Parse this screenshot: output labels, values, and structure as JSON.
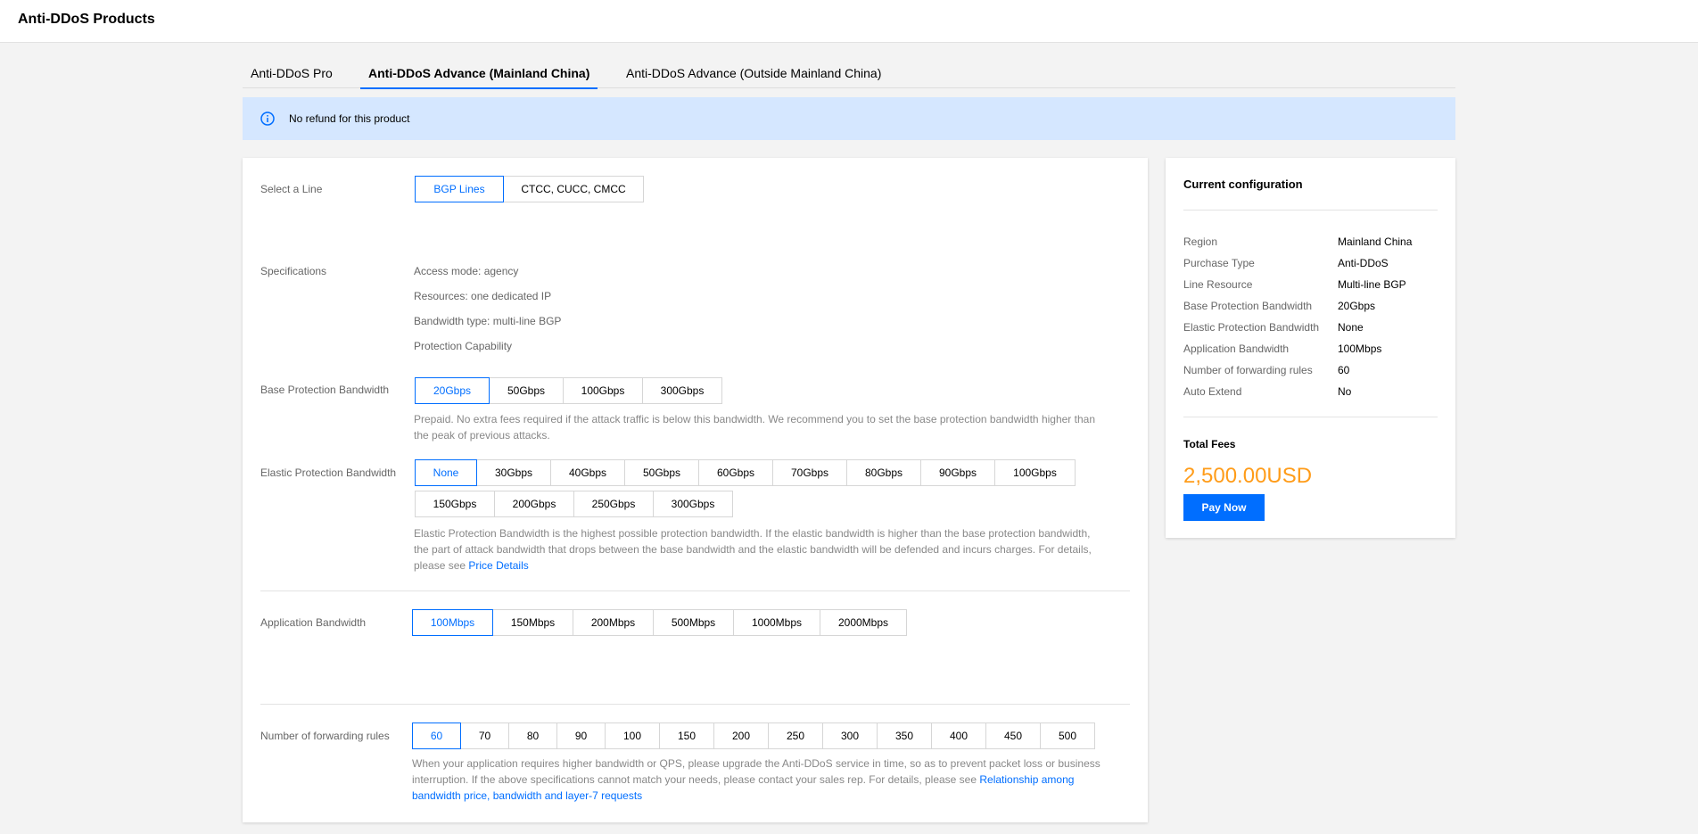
{
  "app": {
    "title": "Anti-DDoS Products"
  },
  "tabs": [
    {
      "label": "Anti-DDoS Pro",
      "active": false
    },
    {
      "label": "Anti-DDoS Advance (Mainland China)",
      "active": true
    },
    {
      "label": "Anti-DDoS Advance (Outside Mainland China)",
      "active": false
    }
  ],
  "notice": {
    "text": "No refund for this product",
    "icon": "info-icon"
  },
  "colors": {
    "accent": "#006eff",
    "notice_bg": "#d5e7ff",
    "fee": "#ff9c19"
  },
  "form": {
    "line": {
      "label": "Select a Line",
      "options": [
        "BGP Lines",
        "CTCC, CUCC, CMCC"
      ],
      "selected": "BGP Lines"
    },
    "specs": {
      "label": "Specifications",
      "items": [
        "Access mode: agency",
        "Resources: one dedicated IP",
        "Bandwidth type: multi-line BGP",
        "Protection Capability"
      ]
    },
    "base": {
      "label": "Base Protection Bandwidth",
      "options": [
        "20Gbps",
        "50Gbps",
        "100Gbps",
        "300Gbps"
      ],
      "selected": "20Gbps",
      "desc_line1": "Prepaid. No extra fees required if the attack traffic is below this bandwidth. We recommend you to set the base protection bandwidth higher than",
      "desc_line2": "the peak of previous attacks."
    },
    "elastic": {
      "label": "Elastic Protection Bandwidth",
      "options_row1": [
        "None",
        "30Gbps",
        "40Gbps",
        "50Gbps",
        "60Gbps",
        "70Gbps",
        "80Gbps",
        "90Gbps",
        "100Gbps"
      ],
      "options_row2": [
        "150Gbps",
        "200Gbps",
        "250Gbps",
        "300Gbps"
      ],
      "selected": "None",
      "desc_line1": "Elastic Protection Bandwidth is the highest possible protection bandwidth. If the elastic bandwidth is higher than the base protection bandwidth,",
      "desc_line2": "the part of attack bandwidth that drops between the base bandwidth and the elastic bandwidth will be defended and incurs charges. For details,",
      "desc_line3": "please see ",
      "desc_link": "Price Details"
    },
    "app_bw": {
      "label": "Application Bandwidth",
      "options": [
        "100Mbps",
        "150Mbps",
        "200Mbps",
        "500Mbps",
        "1000Mbps",
        "2000Mbps"
      ],
      "selected": "100Mbps"
    },
    "rules": {
      "label": "Number of forwarding rules",
      "options": [
        "60",
        "70",
        "80",
        "90",
        "100",
        "150",
        "200",
        "250",
        "300",
        "350",
        "400",
        "450",
        "500"
      ],
      "selected": "60",
      "desc_line1": "When your application requires higher bandwidth or QPS, please upgrade the Anti-DDoS service in time, so as to prevent packet loss or business",
      "desc_line2": "interruption. If the above specifications cannot match your needs, please contact your sales rep. For details, please see ",
      "desc_link_part1": "Relationship among",
      "desc_link_part2": "bandwidth price, bandwidth and layer-7 requests"
    }
  },
  "summary": {
    "title": "Current configuration",
    "rows": [
      {
        "key": "Region",
        "value": "Mainland China"
      },
      {
        "key": "Purchase Type",
        "value": "Anti-DDoS"
      },
      {
        "key": "Line Resource",
        "value": "Multi-line BGP"
      },
      {
        "key": "Base Protection Bandwidth",
        "value": "20Gbps"
      },
      {
        "key": "Elastic Protection Bandwidth",
        "value": "None"
      },
      {
        "key": "Application Bandwidth",
        "value": "100Mbps"
      },
      {
        "key": "Number of forwarding rules",
        "value": "60"
      },
      {
        "key": "Auto Extend",
        "value": "No"
      }
    ],
    "fees_label": "Total Fees",
    "fees_amount": "2,500.00USD",
    "pay_label": "Pay Now"
  }
}
